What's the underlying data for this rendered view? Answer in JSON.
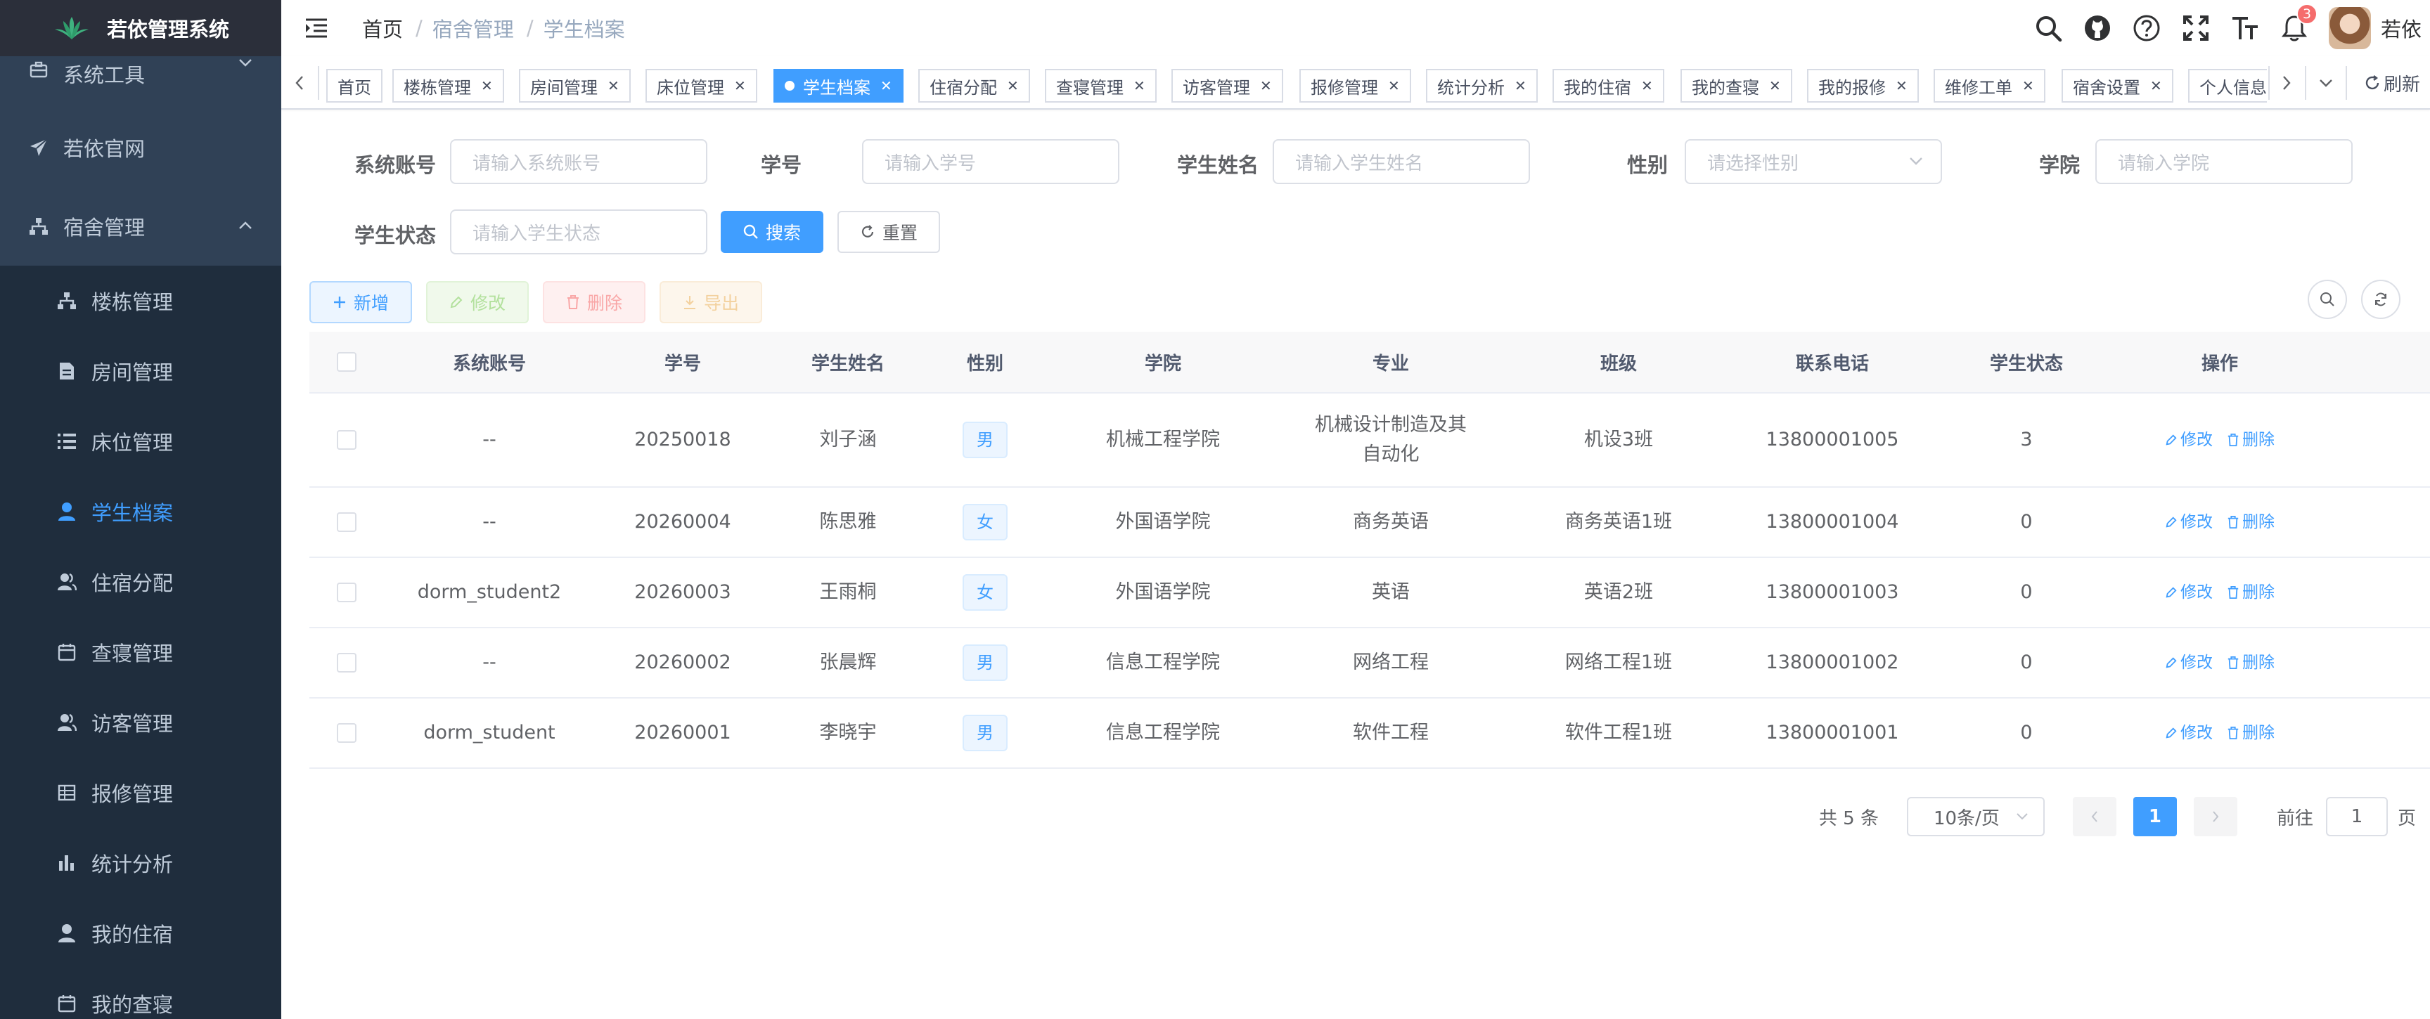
{
  "app": {
    "title": "若依管理系统"
  },
  "sidebar": {
    "items": [
      {
        "label": "系统工具",
        "level": 1,
        "icon": "toolbox-icon",
        "expandable": true,
        "expanded": false
      },
      {
        "label": "若依官网",
        "level": 1,
        "icon": "send-icon"
      },
      {
        "label": "宿舍管理",
        "level": 1,
        "icon": "tree-icon",
        "expandable": true,
        "expanded": true
      },
      {
        "label": "楼栋管理",
        "level": 2,
        "icon": "tree-icon"
      },
      {
        "label": "房间管理",
        "level": 2,
        "icon": "document-icon"
      },
      {
        "label": "床位管理",
        "level": 2,
        "icon": "list-icon"
      },
      {
        "label": "学生档案",
        "level": 2,
        "icon": "user-icon",
        "active": true
      },
      {
        "label": "住宿分配",
        "level": 2,
        "icon": "peoples-icon"
      },
      {
        "label": "查寝管理",
        "level": 2,
        "icon": "calendar-icon"
      },
      {
        "label": "访客管理",
        "level": 2,
        "icon": "peoples-icon"
      },
      {
        "label": "报修管理",
        "level": 2,
        "icon": "table-icon"
      },
      {
        "label": "统计分析",
        "level": 2,
        "icon": "chart-icon"
      },
      {
        "label": "我的住宿",
        "level": 2,
        "icon": "user-icon"
      },
      {
        "label": "我的查寝",
        "level": 2,
        "icon": "calendar-icon"
      }
    ]
  },
  "navbar": {
    "breadcrumb": [
      "首页",
      "宿舍管理",
      "学生档案"
    ],
    "notification_count": "3",
    "user_name": "若依"
  },
  "tagsview": {
    "tags": [
      {
        "label": "首页",
        "closable": false
      },
      {
        "label": "楼栋管理",
        "closable": true
      },
      {
        "label": "房间管理",
        "closable": true
      },
      {
        "label": "床位管理",
        "closable": true
      },
      {
        "label": "学生档案",
        "closable": true,
        "active": true
      },
      {
        "label": "住宿分配",
        "closable": true
      },
      {
        "label": "查寝管理",
        "closable": true
      },
      {
        "label": "访客管理",
        "closable": true
      },
      {
        "label": "报修管理",
        "closable": true
      },
      {
        "label": "统计分析",
        "closable": true
      },
      {
        "label": "我的住宿",
        "closable": true
      },
      {
        "label": "我的查寝",
        "closable": true
      },
      {
        "label": "我的报修",
        "closable": true
      },
      {
        "label": "维修工单",
        "closable": true
      },
      {
        "label": "宿舍设置",
        "closable": true
      },
      {
        "label": "个人信息",
        "closable": true
      }
    ],
    "refresh_label": "刷新"
  },
  "search": {
    "account_label": "系统账号",
    "account_placeholder": "请输入系统账号",
    "student_no_label": "学号",
    "student_no_placeholder": "请输入学号",
    "name_label": "学生姓名",
    "name_placeholder": "请输入学生姓名",
    "gender_label": "性别",
    "gender_placeholder": "请选择性别",
    "college_label": "学院",
    "college_placeholder": "请输入学院",
    "status_label": "学生状态",
    "status_placeholder": "请输入学生状态",
    "search_button": "搜索",
    "reset_button": "重置"
  },
  "toolbar": {
    "add": "新增",
    "edit": "修改",
    "delete": "删除",
    "export": "导出"
  },
  "table": {
    "columns": [
      "系统账号",
      "学号",
      "学生姓名",
      "性别",
      "学院",
      "专业",
      "班级",
      "联系电话",
      "学生状态",
      "操作"
    ],
    "rows": [
      {
        "account": "--",
        "student_no": "20250018",
        "name": "刘子涵",
        "gender": "男",
        "college": "机械工程学院",
        "major": "机械设计制造及其自动化",
        "class": "机设3班",
        "phone": "13800001005",
        "status": "3"
      },
      {
        "account": "--",
        "student_no": "20260004",
        "name": "陈思雅",
        "gender": "女",
        "college": "外国语学院",
        "major": "商务英语",
        "class": "商务英语1班",
        "phone": "13800001004",
        "status": "0"
      },
      {
        "account": "dorm_student2",
        "student_no": "20260003",
        "name": "王雨桐",
        "gender": "女",
        "college": "外国语学院",
        "major": "英语",
        "class": "英语2班",
        "phone": "13800001003",
        "status": "0"
      },
      {
        "account": "--",
        "student_no": "20260002",
        "name": "张晨辉",
        "gender": "男",
        "college": "信息工程学院",
        "major": "网络工程",
        "class": "网络工程1班",
        "phone": "13800001002",
        "status": "0"
      },
      {
        "account": "dorm_student",
        "student_no": "20260001",
        "name": "李晓宇",
        "gender": "男",
        "college": "信息工程学院",
        "major": "软件工程",
        "class": "软件工程1班",
        "phone": "13800001001",
        "status": "0"
      }
    ],
    "row_actions": {
      "edit": "修改",
      "delete": "删除"
    }
  },
  "pagination": {
    "total_text": "共 5 条",
    "page_size": "10条/页",
    "current_page": "1",
    "goto_label": "前往",
    "goto_value": "1",
    "page_suffix": "页"
  },
  "colors": {
    "primary": "#409eff",
    "sidebar_bg": "#304156",
    "sidebar_sub_bg": "#1f2d3d",
    "danger": "#f56c6c"
  }
}
